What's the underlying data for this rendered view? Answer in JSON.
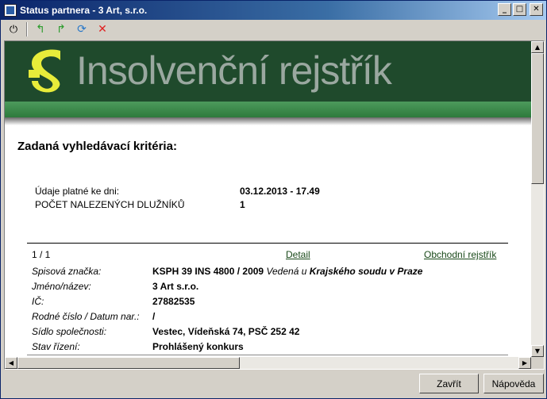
{
  "window": {
    "title": "Status partnera - 3 Art, s.r.o.",
    "controls": {
      "minimize": "_",
      "maximize": "□",
      "close": "✕"
    }
  },
  "toolbar": {
    "power_icon": "⏻",
    "back_icon": "↰",
    "forward_icon": "↱",
    "refresh_icon": "⟳",
    "stop_icon": "✕"
  },
  "banner": {
    "title": "Insolvenční rejstřík"
  },
  "criteria": {
    "heading": "Zadaná vyhledávací kritéria:",
    "rows": [
      {
        "label": "Údaje platné ke dni:",
        "value": "03.12.2013 - 17.49"
      },
      {
        "label": "POČET NALEZENÝCH DLUŽNÍKŮ",
        "value": "1"
      }
    ]
  },
  "result": {
    "pager": "1 / 1",
    "detail_link": "Detail",
    "registry_link": "Obchodní rejstřík",
    "fields": [
      {
        "label": "Spisová značka:",
        "value": "KSPH 39 INS 4800 / 2009",
        "suffix": "Vedená u",
        "court": "Krajského soudu v Praze"
      },
      {
        "label": "Jméno/název:",
        "value": "3 Art s.r.o."
      },
      {
        "label": "IČ:",
        "value": "27882535"
      },
      {
        "label": "Rodné číslo / Datum nar.:",
        "value": "/"
      },
      {
        "label": "Sídlo společnosti:",
        "value": "Vestec, Vídeňská 74, PSČ 252 42"
      },
      {
        "label": "Stav řízení:",
        "value": "Prohlášený konkurs"
      }
    ]
  },
  "scrollbars": {
    "up": "▲",
    "down": "▼",
    "left": "◀",
    "right": "▶"
  },
  "footer": {
    "close_label": "Zavřít",
    "help_label": "Nápověda"
  },
  "colors": {
    "banner_bg": "#1f4a2c",
    "banner_stripe": "#3d8a4c",
    "logo": "#e8ec3a",
    "link": "#1a4a1a"
  }
}
